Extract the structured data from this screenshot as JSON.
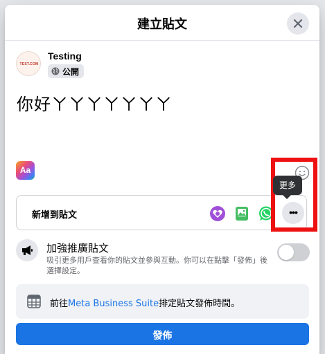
{
  "dialog": {
    "title": "建立貼文",
    "close_icon": "close-icon"
  },
  "author": {
    "name": "Testing",
    "avatar_text": "TEST.COM",
    "privacy": "公開",
    "privacy_icon": "globe-icon"
  },
  "composer": {
    "text": "你好ㄚㄚㄚㄚㄚㄚㄚ",
    "background_button": "Aa",
    "emoji_icon": "smiley-icon"
  },
  "add_to_post": {
    "label": "新增到貼文",
    "icons": [
      "feeling-heart-icon",
      "photo-video-icon",
      "whatsapp-icon"
    ],
    "more_label": "•••",
    "tooltip": "更多"
  },
  "boost": {
    "title": "加強推廣貼文",
    "description": "吸引更多用戶查看你的貼文並參與互動。你可以在點擊「發佈」後選擇設定。",
    "toggle_on": false
  },
  "schedule": {
    "prefix": "前往",
    "link": "Meta Business Suite",
    "suffix": "排定貼文發佈時間。"
  },
  "post_button": "發佈",
  "colors": {
    "primary": "#1b74e4",
    "highlight": "#ee1111",
    "tooltip_bg": "#303134"
  }
}
